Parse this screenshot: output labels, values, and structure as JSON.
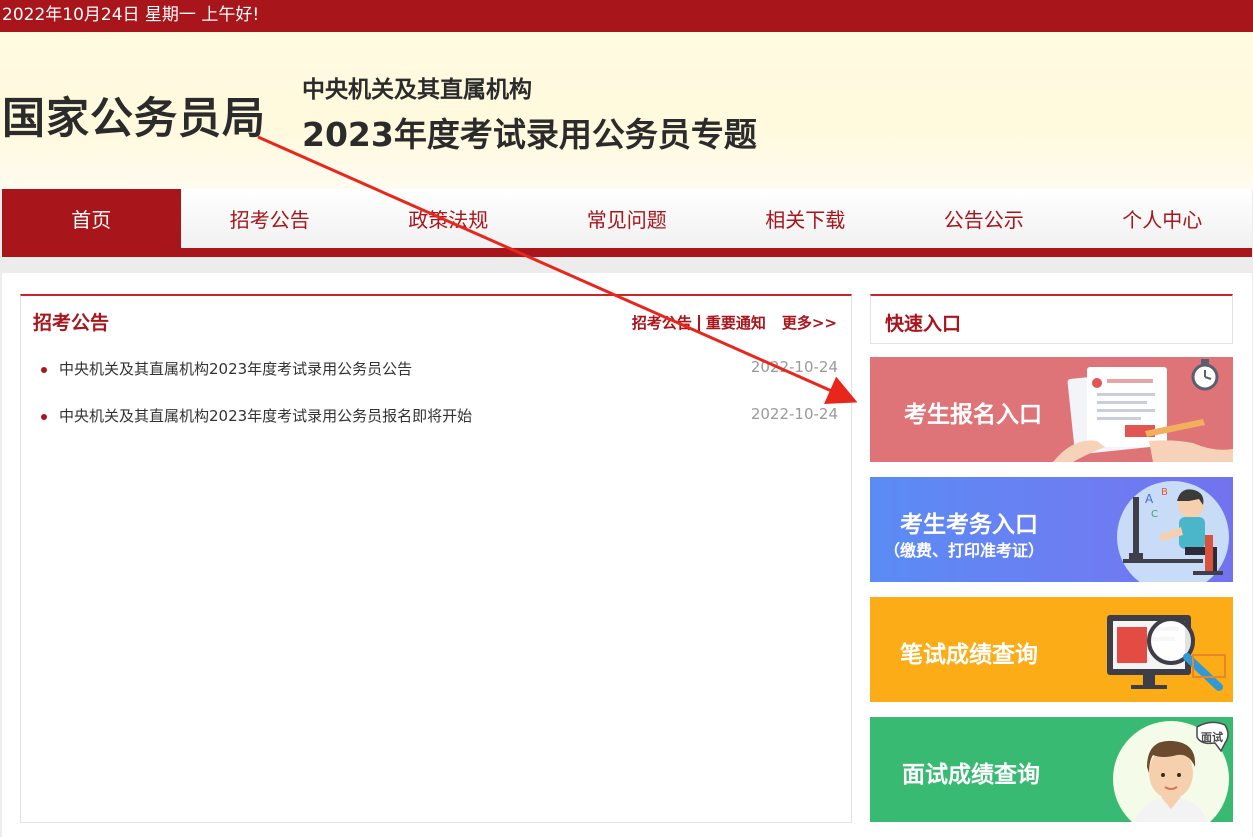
{
  "topbar": {
    "text": "2022年10月24日  星期一  上午好!"
  },
  "header": {
    "org_name": "国家公务员局",
    "subtitle_line1": "中央机关及其直属机构",
    "subtitle_line2": "2023年度考试录用公务员专题"
  },
  "nav": {
    "items": [
      {
        "label": "首页",
        "active": true
      },
      {
        "label": "招考公告",
        "active": false
      },
      {
        "label": "政策法规",
        "active": false
      },
      {
        "label": "常见问题",
        "active": false
      },
      {
        "label": "相关下载",
        "active": false
      },
      {
        "label": "公告公示",
        "active": false
      },
      {
        "label": "个人中心",
        "active": false
      }
    ]
  },
  "news": {
    "title": "招考公告",
    "links": {
      "link1": "招考公告",
      "link2": "重要通知",
      "more": "更多>>"
    },
    "items": [
      {
        "title": "中央机关及其直属机构2023年度考试录用公务员公告",
        "date": "2022-10-24"
      },
      {
        "title": "中央机关及其直属机构2023年度考试录用公务员报名即将开始",
        "date": "2022-10-24"
      }
    ]
  },
  "quick": {
    "title": "快速入口",
    "buttons": [
      {
        "label": "考生报名入口",
        "sub": "",
        "color": "#de7478",
        "icon": "application-form-icon"
      },
      {
        "label": "考生考务入口",
        "sub": "（缴费、打印准考证）",
        "color": "#6a80f3",
        "icon": "student-at-computer-icon"
      },
      {
        "label": "笔试成绩查询",
        "sub": "",
        "color": "#fbac17",
        "icon": "magnifier-monitor-icon"
      },
      {
        "label": "面试成绩查询",
        "sub": "",
        "color": "#38ba73",
        "icon": "interview-person-icon"
      }
    ],
    "interview_badge": "面试"
  },
  "colors": {
    "brand_red": "#a8151b",
    "header_bg": "#fffbe1",
    "annotation_arrow": "#e8261c"
  }
}
